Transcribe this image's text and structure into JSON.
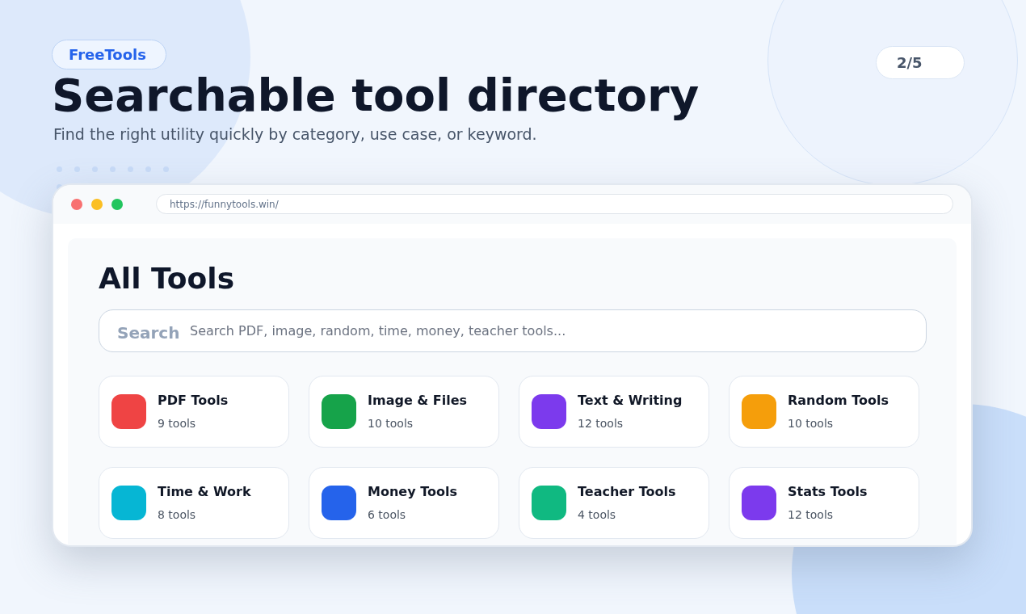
{
  "brand": "FreeTools",
  "page_indicator": "2/5",
  "headline": "Searchable tool directory",
  "subtitle": "Find the right utility quickly by category, use case, or keyword.",
  "browser": {
    "url": "https://funnytools.win/"
  },
  "page": {
    "heading": "All Tools",
    "search": {
      "label": "Search",
      "placeholder": "Search PDF, image, random, time, money, teacher tools..."
    },
    "categories": [
      {
        "name": "PDF Tools",
        "count": "9 tools",
        "color": "#ef4444"
      },
      {
        "name": "Image & Files",
        "count": "10 tools",
        "color": "#16a34a"
      },
      {
        "name": "Text & Writing",
        "count": "12 tools",
        "color": "#7c3aed"
      },
      {
        "name": "Random Tools",
        "count": "10 tools",
        "color": "#f59e0b"
      },
      {
        "name": "Time & Work",
        "count": "8 tools",
        "color": "#06b6d4"
      },
      {
        "name": "Money Tools",
        "count": "6 tools",
        "color": "#2563eb"
      },
      {
        "name": "Teacher Tools",
        "count": "4 tools",
        "color": "#10b981"
      },
      {
        "name": "Stats Tools",
        "count": "12 tools",
        "color": "#7c3aed"
      }
    ]
  }
}
